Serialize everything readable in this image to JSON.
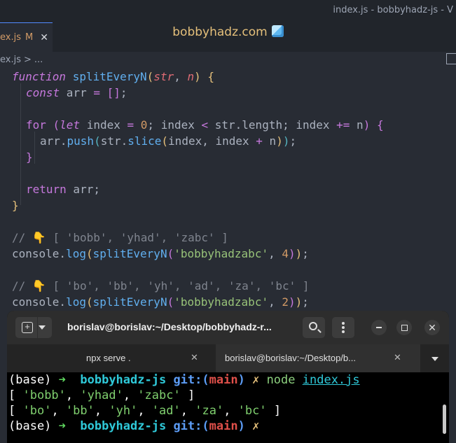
{
  "window_title": "index.js - bobbyhadz-js - V",
  "editor": {
    "active_tab": {
      "name": "ex.js",
      "modified_marker": "M",
      "close_glyph": "✕"
    },
    "center_title": "bobbyhadz.com",
    "center_icon": "cube-icon",
    "breadcrumb": {
      "file": "ex.js",
      "separator": ">",
      "rest": "..."
    },
    "code": {
      "l1": {
        "kw": "function",
        "name": "splitEveryN",
        "open": "(",
        "p1": "str",
        "comma": ", ",
        "p2": "n",
        "close": ")",
        "brace": " {"
      },
      "l2": {
        "kw": "const",
        "var": " arr ",
        "eq": "=",
        "arr": " []",
        "semi": ";"
      },
      "l4": {
        "kw": "for",
        "open": " (",
        "let": "let",
        "idx": " index ",
        "eq": "=",
        "zero": " 0",
        "mid": "; index ",
        "lt": "<",
        "len": " str.length; index ",
        "pe": "+=",
        "n": " n",
        "close": ")",
        "brace": " {"
      },
      "l5": {
        "obj": "arr.",
        "fn": "push",
        "open": "(",
        "obj2": "str.",
        "fn2": "slice",
        "open2": "(",
        "args": "index, index ",
        "plus": "+",
        "n": " n",
        "close2": ")",
        "close": ")",
        "semi": ";"
      },
      "l6": {
        "brace": "}"
      },
      "l8": {
        "kw": "return",
        "rest": " arr;"
      },
      "l9": {
        "brace": "}"
      },
      "l11": {
        "slashes": "// ",
        "hand": "👇",
        "text": " [ 'bobb', 'yhad', 'zabc' ]"
      },
      "l12": {
        "obj": "console.",
        "fn": "log",
        "open": "(",
        "fn2": "splitEveryN",
        "open2": "(",
        "str": "'bobbyhadzabc'",
        "comma": ", ",
        "num": "4",
        "close2": ")",
        "close": ")",
        "semi": ";"
      },
      "l14": {
        "slashes": "// ",
        "hand": "👇",
        "text": " [ 'bo', 'bb', 'yh', 'ad', 'za', 'bc' ]"
      },
      "l15": {
        "obj": "console.",
        "fn": "log",
        "open": "(",
        "fn2": "splitEveryN",
        "open2": "(",
        "str": "'bobbyhadzabc'",
        "comma": ", ",
        "num": "2",
        "close2": ")",
        "close": ")",
        "semi": ";"
      }
    }
  },
  "terminal": {
    "title": "borislav@borislav:~/Desktop/bobbyhadz-r...",
    "tabs": [
      {
        "label": "npx serve .",
        "close": "✕"
      },
      {
        "label": "borislav@borislav:~/Desktop/b...",
        "close": "✕"
      }
    ],
    "lines": {
      "p1": {
        "base": "(base) ",
        "arrow": "➜ ",
        "dir": " bobbyhadz-js ",
        "git": "git:",
        "paren_open": "(",
        "branch": "main",
        "paren_close": ")",
        "x": " ✗ ",
        "cmd": "node ",
        "arg": "index.js"
      },
      "o1": {
        "open": "[ ",
        "s1": "'bobb'",
        "c1": ", ",
        "s2": "'yhad'",
        "c2": ", ",
        "s3": "'zabc'",
        "close": " ]"
      },
      "o2": {
        "open": "[ ",
        "s1": "'bo'",
        "c1": ", ",
        "s2": "'bb'",
        "c2": ", ",
        "s3": "'yh'",
        "c3": ", ",
        "s4": "'ad'",
        "c4": ", ",
        "s5": "'za'",
        "c5": ", ",
        "s6": "'bc'",
        "close": " ]"
      },
      "p2": {
        "base": "(base) ",
        "arrow": "➜ ",
        "dir": " bobbyhadz-js ",
        "git": "git:",
        "paren_open": "(",
        "branch": "main",
        "paren_close": ")",
        "x": " ✗"
      }
    }
  }
}
